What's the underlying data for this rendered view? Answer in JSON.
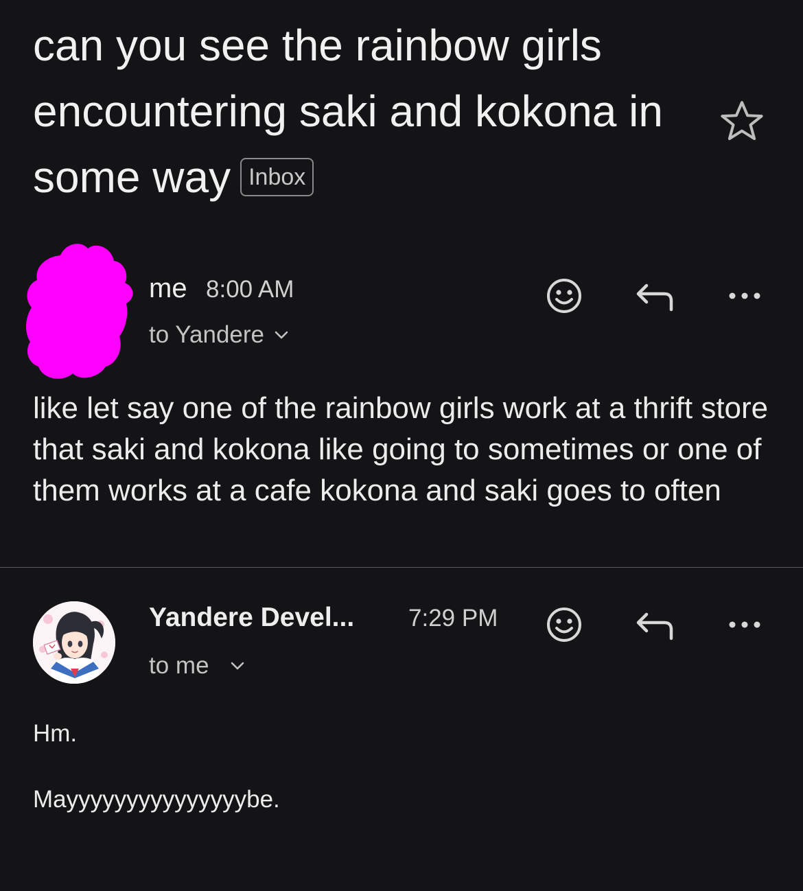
{
  "thread": {
    "subject": "can you see the rainbow girls encountering saki and kokona in some way",
    "label": "Inbox"
  },
  "messages": [
    {
      "sender": "me",
      "time": "8:00 AM",
      "recipient": "to Yandere",
      "body": "like let say one of the rainbow girls work at a thrift store that saki and kokona like going to sometimes or one of them works at a cafe kokona and saki goes to often",
      "avatar_color": "#ff00ff"
    },
    {
      "sender": "Yandere Devel...",
      "time": "7:29 PM",
      "recipient": "to me",
      "body_lines": [
        "Hm.",
        "Mayyyyyyyyyyyyyyybe."
      ]
    }
  ],
  "icons": {
    "star": "star-icon",
    "emoji": "smiley-icon",
    "reply": "reply-icon",
    "more": "more-icon",
    "chevron": "chevron-down-icon"
  },
  "colors": {
    "background": "#141416",
    "text": "#ececec",
    "divider": "#5a5a5a"
  }
}
